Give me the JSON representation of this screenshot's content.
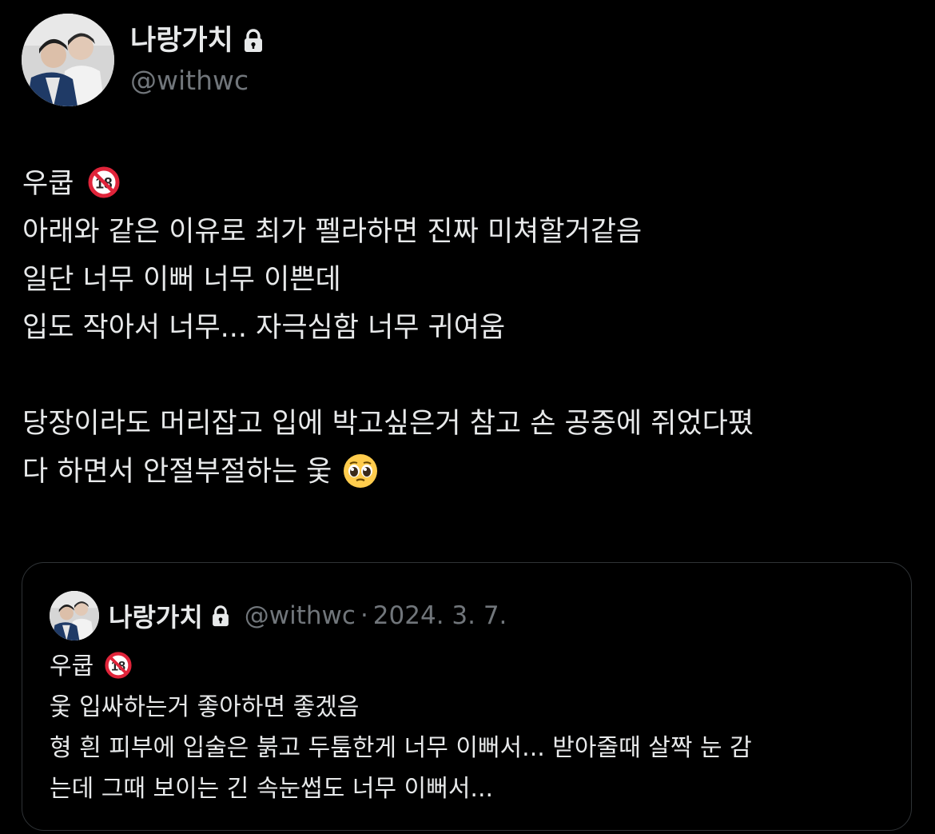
{
  "tweet": {
    "author": {
      "display_name": "나랑가치",
      "handle": "@withwc",
      "avatar_icon": "avatar-photo",
      "protected_icon": "lock-icon"
    },
    "body": {
      "line1": "우쿱",
      "line1_badge": "🔞",
      "line2": "아래와 같은 이유로 최가 펠라하면 진짜 미쳐할거같음",
      "line3": "일단 너무 이뻐 너무 이쁜데",
      "line4": "입도 작아서 너무... 자극심함 너무 귀여움",
      "line5": "당장이라도 머리잡고 입에 박고싶은거 참고 손 공중에 쥐었다폈",
      "line6": "다 하면서 안절부절하는 웇",
      "line6_emoji": "🥹"
    }
  },
  "quote": {
    "author": {
      "display_name": "나랑가치",
      "handle": "@withwc",
      "separator": "·",
      "date": "2024. 3. 7."
    },
    "body": {
      "line1": "우쿱",
      "line1_badge": "🔞",
      "line2": "웇 입싸하는거 좋아하면 좋겠음",
      "line3": "형 흰 피부에 입술은 붉고 두툼한게 너무 이뻐서... 받아줄때 살짝 눈 감",
      "line4": "는데 그때 보이는 긴 속눈썹도 너무 이뻐서..."
    }
  },
  "colors": {
    "background": "#000000",
    "text_primary": "#e7e9ea",
    "text_secondary": "#71767b",
    "border": "#2f3336",
    "badge_red": "#e0243a"
  }
}
